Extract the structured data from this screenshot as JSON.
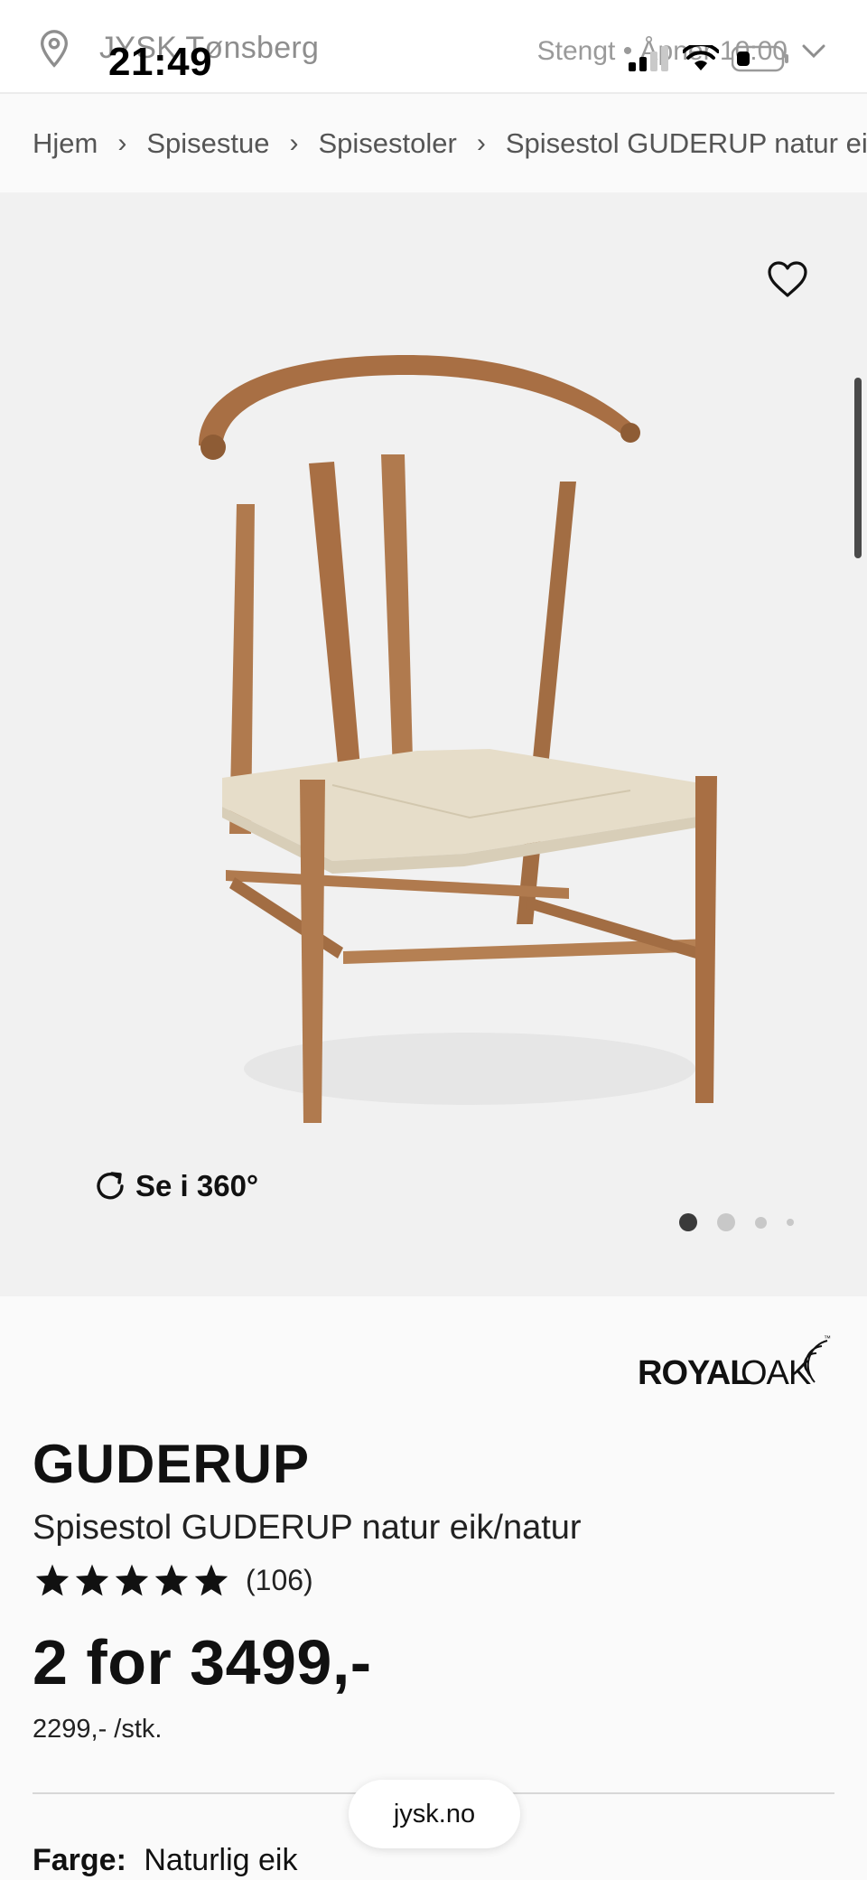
{
  "store": {
    "name": "JYSK Tønsberg",
    "hours": "Stengt • Åpner 10:00"
  },
  "status_bar": {
    "time": "21:49"
  },
  "breadcrumb": [
    {
      "label": "Hjem"
    },
    {
      "label": "Spisestue"
    },
    {
      "label": "Spisestoler"
    },
    {
      "label": "Spisestol GUDERUP natur eik/natur"
    }
  ],
  "breadcrumb_separator": "›",
  "gallery": {
    "view360_label": "Se i 360°",
    "slide_count": 4,
    "active_slide": 1
  },
  "product": {
    "brand": "ROYAL OAK",
    "brand_tm": "™",
    "name": "GUDERUP",
    "description": "Spisestol GUDERUP natur eik/natur",
    "rating_stars": 5,
    "review_count": "(106)",
    "price": "2 for 3499,-",
    "unit_price": "2299,- /stk.",
    "color_label": "Farge:",
    "color_value": "Naturlig eik"
  },
  "browser": {
    "url": "jysk.no"
  },
  "colors": {
    "wood": "#b07a4e",
    "wood_dark": "#8e5c35",
    "seat": "#e6ddc9",
    "gallery_bg": "#f1f1f1"
  }
}
